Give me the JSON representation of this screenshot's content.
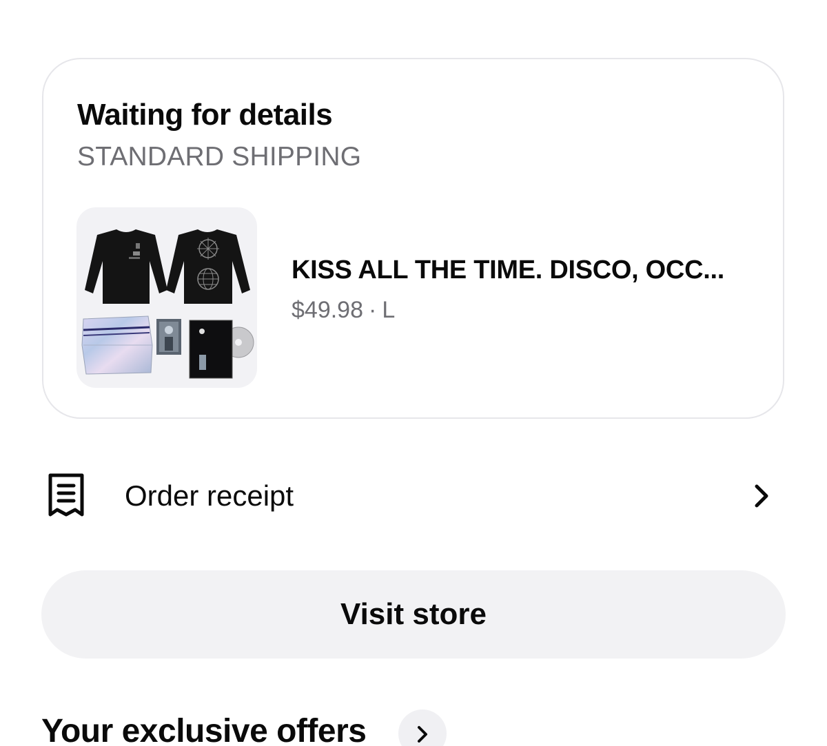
{
  "order": {
    "status_title": "Waiting for details",
    "shipping_method": "STANDARD SHIPPING",
    "product": {
      "image_alt": "Black long sleeve shirts, holographic box, photo card and CD bundle",
      "title": "KISS ALL THE TIME. DISCO, OCC...",
      "price": "$49.98",
      "separator": "·",
      "size": "L"
    }
  },
  "receipt": {
    "label": "Order receipt",
    "icon": "receipt-icon",
    "chevron_icon": "chevron-right-icon"
  },
  "visit_store": {
    "label": "Visit store"
  },
  "offers": {
    "title": "Your exclusive offers",
    "chevron_icon": "chevron-right-icon"
  },
  "colors": {
    "background": "#ffffff",
    "card_border": "#e6e6ea",
    "secondary_text": "#6e6e73",
    "button_bg": "#f2f2f4",
    "primary_text": "#0a0a0a"
  }
}
